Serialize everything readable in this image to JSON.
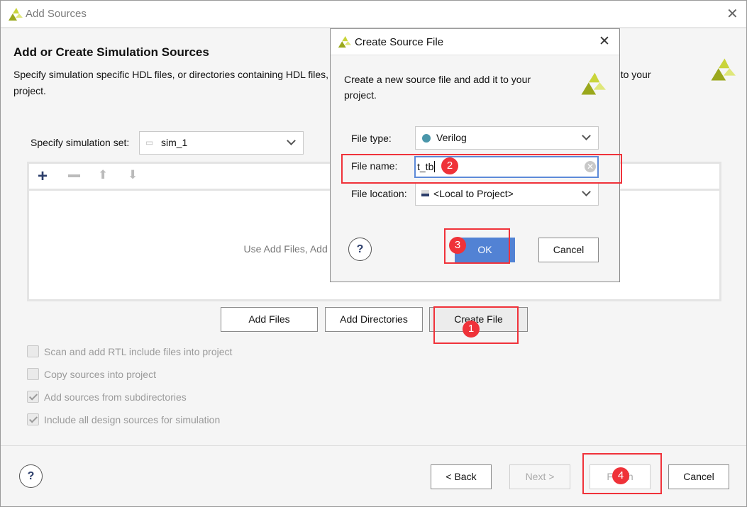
{
  "window": {
    "title": "Add Sources"
  },
  "main": {
    "heading": "Add or Create Simulation Sources",
    "description_line1": "Specify simulation specific HDL files, or directories containing HDL files, to add to your project. Create a new source file on disk and add it to your",
    "description_line2": "project.",
    "sim_set_label": "Specify simulation set:",
    "sim_set_value": "sim_1",
    "empty_hint": "Use Add Files, Add Directories or Create File buttons below",
    "buttons": {
      "add_files": "Add Files",
      "add_directories": "Add Directories",
      "create_file": "Create File"
    },
    "options": [
      {
        "label": "Scan and add RTL include files into project",
        "checked": false
      },
      {
        "label": "Copy sources into project",
        "checked": false
      },
      {
        "label": "Add sources from subdirectories",
        "checked": true
      },
      {
        "label": "Include all design sources for simulation",
        "checked": true
      }
    ],
    "footer": {
      "back": "< Back",
      "next": "Next >",
      "finish": "Finish",
      "cancel": "Cancel",
      "help": "?"
    }
  },
  "dialog": {
    "title": "Create Source File",
    "description": "Create a new source file and add it to your project.",
    "file_type_label": "File type:",
    "file_type_value": "Verilog",
    "file_name_label": "File name:",
    "file_name_value": "t_tb",
    "file_location_label": "File location:",
    "file_location_value": "<Local to Project>",
    "ok": "OK",
    "cancel": "Cancel",
    "help": "?"
  },
  "annotations": [
    "1",
    "2",
    "3",
    "4"
  ],
  "colors": {
    "accent_blue": "#5282d4",
    "annotation_red": "#ef3239",
    "verilog_dot": "#4a96aa",
    "logo_green": "#9aa81c"
  }
}
